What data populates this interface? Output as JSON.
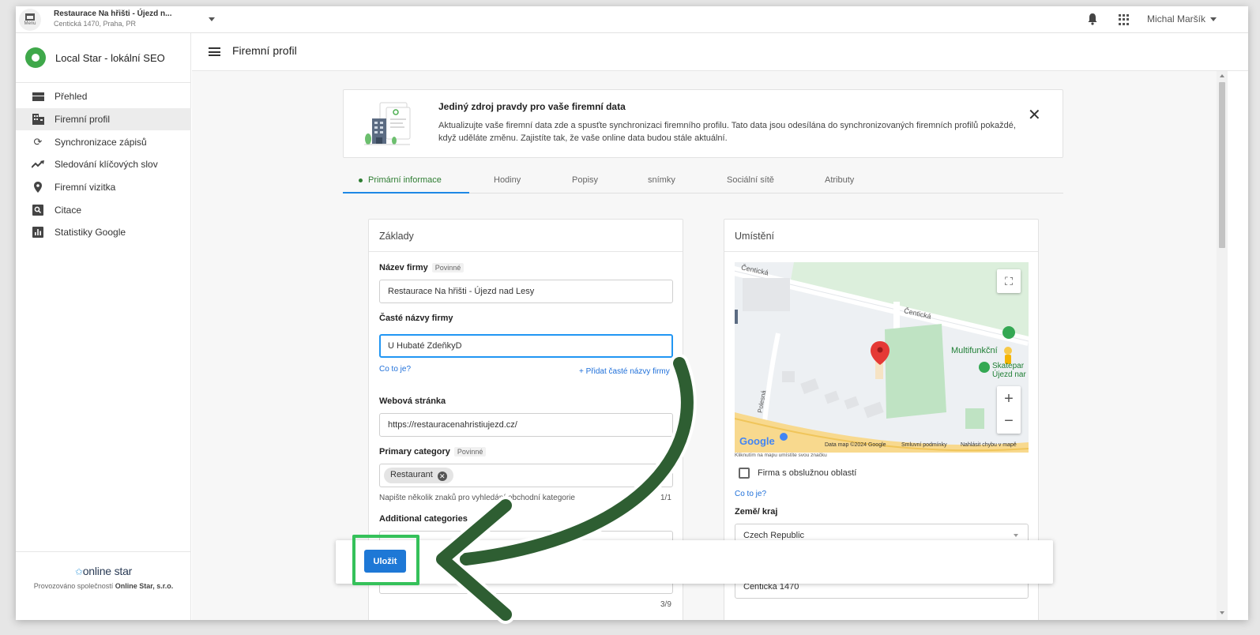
{
  "topbar": {
    "menu_label": "Menu",
    "business_name": "Restaurace Na hřišti - Újezd n...",
    "business_address": "Centická 1470, Praha, PR",
    "user_name": "Michal Maršík"
  },
  "sidebar": {
    "brand": "Local Star - lokální SEO",
    "items": [
      {
        "label": "Přehled",
        "icon": "dashboard-icon"
      },
      {
        "label": "Firemní profil",
        "icon": "building-icon"
      },
      {
        "label": "Synchronizace zápisů",
        "icon": "sync-icon"
      },
      {
        "label": "Sledování klíčových slov",
        "icon": "trending-icon"
      },
      {
        "label": "Firemní vizitka",
        "icon": "location-pin-icon"
      },
      {
        "label": "Citace",
        "icon": "search-box-icon"
      },
      {
        "label": "Statistiky Google",
        "icon": "bar-chart-icon"
      }
    ],
    "active_index": 1,
    "footer_logo": "online star",
    "footer_credit_prefix": "Provozováno společností",
    "footer_credit_company": "Online Star, s.r.o."
  },
  "header": {
    "title": "Firemní profil"
  },
  "banner": {
    "title": "Jediný zdroj pravdy pro vaše firemní data",
    "text": "Aktualizujte vaše firemní data zde a spusťte synchronizaci firemního profilu. Tato data jsou odesílána do synchronizovaných firemních profilů pokaždé, když uděláte změnu. Zajistíte tak, že vaše online data budou stále aktuální."
  },
  "tabs": [
    {
      "label": "Primární informace",
      "active": true
    },
    {
      "label": "Hodiny"
    },
    {
      "label": "Popisy"
    },
    {
      "label": "snímky"
    },
    {
      "label": "Sociální sítě"
    },
    {
      "label": "Atributy"
    }
  ],
  "basics": {
    "title": "Základy",
    "required_tag": "Povinné",
    "name_label": "Název firmy",
    "name_value": "Restaurace Na hřišti - Újezd nad Lesy",
    "alt_names_label": "Časté názvy firmy",
    "alt_names_value": "U Hubaté ZdeňkyD",
    "what_is_it": "Co to je?",
    "add_alt_names": "+ Přidat časté názvy firmy",
    "website_label": "Webová stránka",
    "website_value": "https://restauracenahristiujezd.cz/",
    "primary_category_label": "Primary category",
    "primary_category_chip": "Restaurant",
    "category_hint": "Napište několik znaků pro vyhledání obchodní kategorie",
    "primary_count": "1/1",
    "additional_categories_label": "Additional categories",
    "additional_count": "3/9"
  },
  "location": {
    "title": "Umístění",
    "map_street_1": "Čentická",
    "map_street_2": "Čentická",
    "map_street_3": "Polesná",
    "map_place_1": "Multifunkční",
    "map_place_2": "Skatepar",
    "map_place_3": "Újezd nar",
    "map_google": "Google",
    "map_data": "Data map ©2024 Google",
    "map_terms": "Smluvní podmínky",
    "map_report": "Nahlásit chybu v mapě",
    "map_hint": "Kliknutím na mapu umístíte svou značku",
    "service_area_label": "Firma s obslužnou oblastí",
    "what_is_it": "Co to je?",
    "country_label": "Země/ kraj",
    "country_value": "Czech Republic",
    "street_value": "Čentická 1470"
  },
  "actions": {
    "save_label": "Uložit"
  },
  "colors": {
    "accent_green": "#2e7d32",
    "brand_green": "#3fa84a",
    "primary_blue": "#1e78d6",
    "highlight_green": "#35c15a",
    "annotation_arrow": "#2e5e32"
  }
}
